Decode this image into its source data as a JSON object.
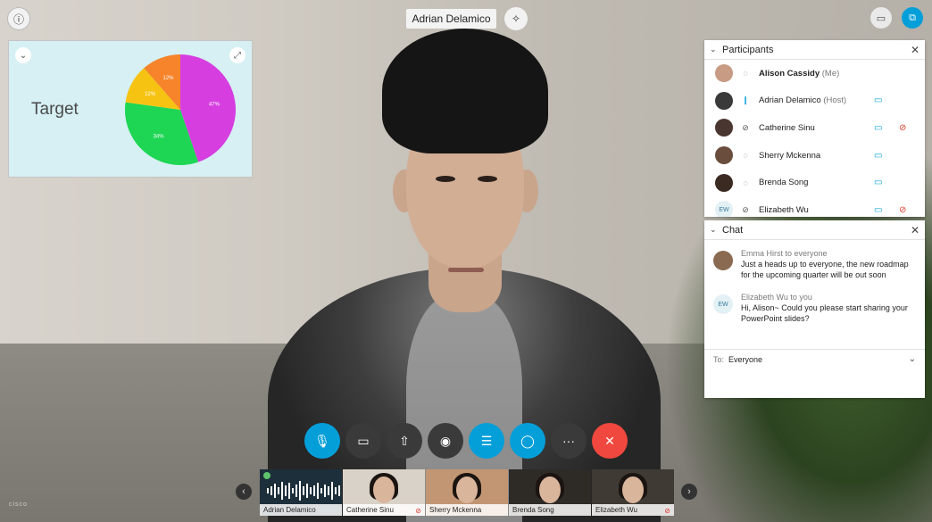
{
  "header": {
    "active_speaker": "Adrian Delamico",
    "info_icon": "info-icon",
    "pin_icon": "pin-icon",
    "layout_icon": "layout-icon",
    "popout_icon": "popout-icon"
  },
  "share": {
    "title": "Target",
    "collapse_icon": "chevron-down-icon",
    "expand_icon": "expand-icon",
    "chart_data": {
      "type": "pie",
      "slices": [
        {
          "label": "47%",
          "value": 47,
          "color": "#d63ee0"
        },
        {
          "label": "34%",
          "value": 34,
          "color": "#1ed654"
        },
        {
          "label": "12%",
          "value": 12,
          "color": "#f6c312"
        },
        {
          "label": "12%",
          "value": 12,
          "color": "#f7832a"
        }
      ]
    }
  },
  "participants": {
    "title": "Participants",
    "close_icon": "close-icon",
    "rows": [
      {
        "name": "Alison Cassidy",
        "role": "(Me)",
        "bold": true,
        "mic": "mic-icon",
        "video": false,
        "muted": false,
        "avatar": "photo",
        "avatar_color": "#c79b84"
      },
      {
        "name": "Adrian Delamico",
        "role": "(Host)",
        "bold": false,
        "mic": "mic-active-icon",
        "video": true,
        "muted": false,
        "avatar": "photo",
        "avatar_color": "#3a3a3a"
      },
      {
        "name": "Catherine Sinu",
        "role": "",
        "bold": false,
        "mic": "mic-off-icon",
        "video": true,
        "muted": true,
        "avatar": "photo",
        "avatar_color": "#4a3630"
      },
      {
        "name": "Sherry Mckenna",
        "role": "",
        "bold": false,
        "mic": "mic-icon",
        "video": true,
        "muted": false,
        "avatar": "photo",
        "avatar_color": "#6b4d3e"
      },
      {
        "name": "Brenda Song",
        "role": "",
        "bold": false,
        "mic": "mic-icon",
        "video": true,
        "muted": false,
        "avatar": "photo",
        "avatar_color": "#3b2a22"
      },
      {
        "name": "Elizabeth Wu",
        "role": "",
        "bold": false,
        "mic": "mic-off-icon",
        "video": true,
        "muted": true,
        "avatar": "EW",
        "avatar_color": "#e3f1f5"
      }
    ]
  },
  "chat": {
    "title": "Chat",
    "close_icon": "close-icon",
    "messages": [
      {
        "meta": "Emma Hirst to everyone",
        "text": "Just a heads up to everyone, the new roadmap for the upcoming quarter will be out soon",
        "avatar": "photo",
        "avatar_color": "#8a6a50"
      },
      {
        "meta": "Elizabeth Wu to you",
        "text": "Hi, Alison~ Could you please start sharing your PowerPoint slides?",
        "avatar": "EW",
        "avatar_color": "#e3f1f5"
      }
    ],
    "to_label": "To:",
    "to_value": "Everyone"
  },
  "controls": [
    {
      "name": "mute-button",
      "icon": "mic-icon",
      "glyph": "🎙",
      "style": "blue"
    },
    {
      "name": "video-button",
      "icon": "video-camera-icon",
      "glyph": "▭",
      "style": "dark"
    },
    {
      "name": "share-button",
      "icon": "share-upload-icon",
      "glyph": "⇧",
      "style": "dark"
    },
    {
      "name": "record-button",
      "icon": "record-icon",
      "glyph": "◉",
      "style": "dark"
    },
    {
      "name": "participants-button",
      "icon": "participants-icon",
      "glyph": "☰",
      "style": "blue"
    },
    {
      "name": "chat-button",
      "icon": "chat-bubble-icon",
      "glyph": "◯",
      "style": "blue"
    },
    {
      "name": "more-button",
      "icon": "more-icon",
      "glyph": "···",
      "style": "dark"
    },
    {
      "name": "leave-button",
      "icon": "close-icon",
      "glyph": "✕",
      "style": "red"
    }
  ],
  "filmstrip": [
    {
      "name": "Adrian Delamico",
      "muted": false,
      "kind": "audio",
      "bg": "#1d2f3a"
    },
    {
      "name": "Catherine Sinu",
      "muted": true,
      "kind": "video",
      "bg": "#d9d2c8"
    },
    {
      "name": "Sherry Mckenna",
      "muted": false,
      "kind": "video",
      "bg": "#c29673"
    },
    {
      "name": "Brenda Song",
      "muted": false,
      "kind": "video",
      "bg": "#2e2a26"
    },
    {
      "name": "Elizabeth Wu",
      "muted": true,
      "kind": "video",
      "bg": "#3f3a34"
    }
  ],
  "brand": "cisco"
}
